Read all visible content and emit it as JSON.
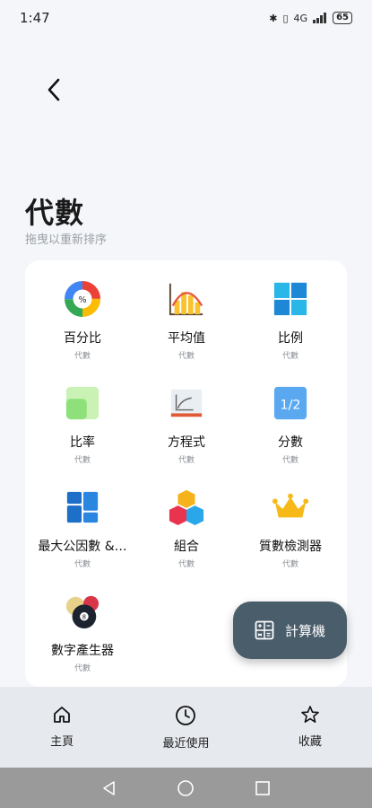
{
  "status_bar": {
    "time": "1:47",
    "network": "4G",
    "battery": "65"
  },
  "header": {
    "title": "代數",
    "subtitle": "拖曳以重新排序"
  },
  "tiles": [
    {
      "name": "百分比",
      "category": "代數",
      "icon": "percentage-donut-icon"
    },
    {
      "name": "平均值",
      "category": "代數",
      "icon": "average-chart-icon"
    },
    {
      "name": "比例",
      "category": "代數",
      "icon": "grid-squares-icon"
    },
    {
      "name": "比率",
      "category": "代數",
      "icon": "ratio-squares-icon"
    },
    {
      "name": "方程式",
      "category": "代數",
      "icon": "equation-graph-icon"
    },
    {
      "name": "分數",
      "category": "代數",
      "icon": "fraction-icon"
    },
    {
      "name": "最大公因數 &…",
      "category": "代數",
      "icon": "gcd-blocks-icon"
    },
    {
      "name": "組合",
      "category": "代數",
      "icon": "combination-cubes-icon"
    },
    {
      "name": "質數檢測器",
      "category": "代數",
      "icon": "crown-icon"
    },
    {
      "name": "數字產生器",
      "category": "代數",
      "icon": "billiard-balls-icon"
    }
  ],
  "fab": {
    "label": "計算機",
    "icon": "calculator-icon"
  },
  "bottom_nav": [
    {
      "label": "主頁",
      "icon": "home-icon"
    },
    {
      "label": "最近使用",
      "icon": "clock-icon"
    },
    {
      "label": "收藏",
      "icon": "star-icon"
    }
  ],
  "fraction_label": "1/2"
}
